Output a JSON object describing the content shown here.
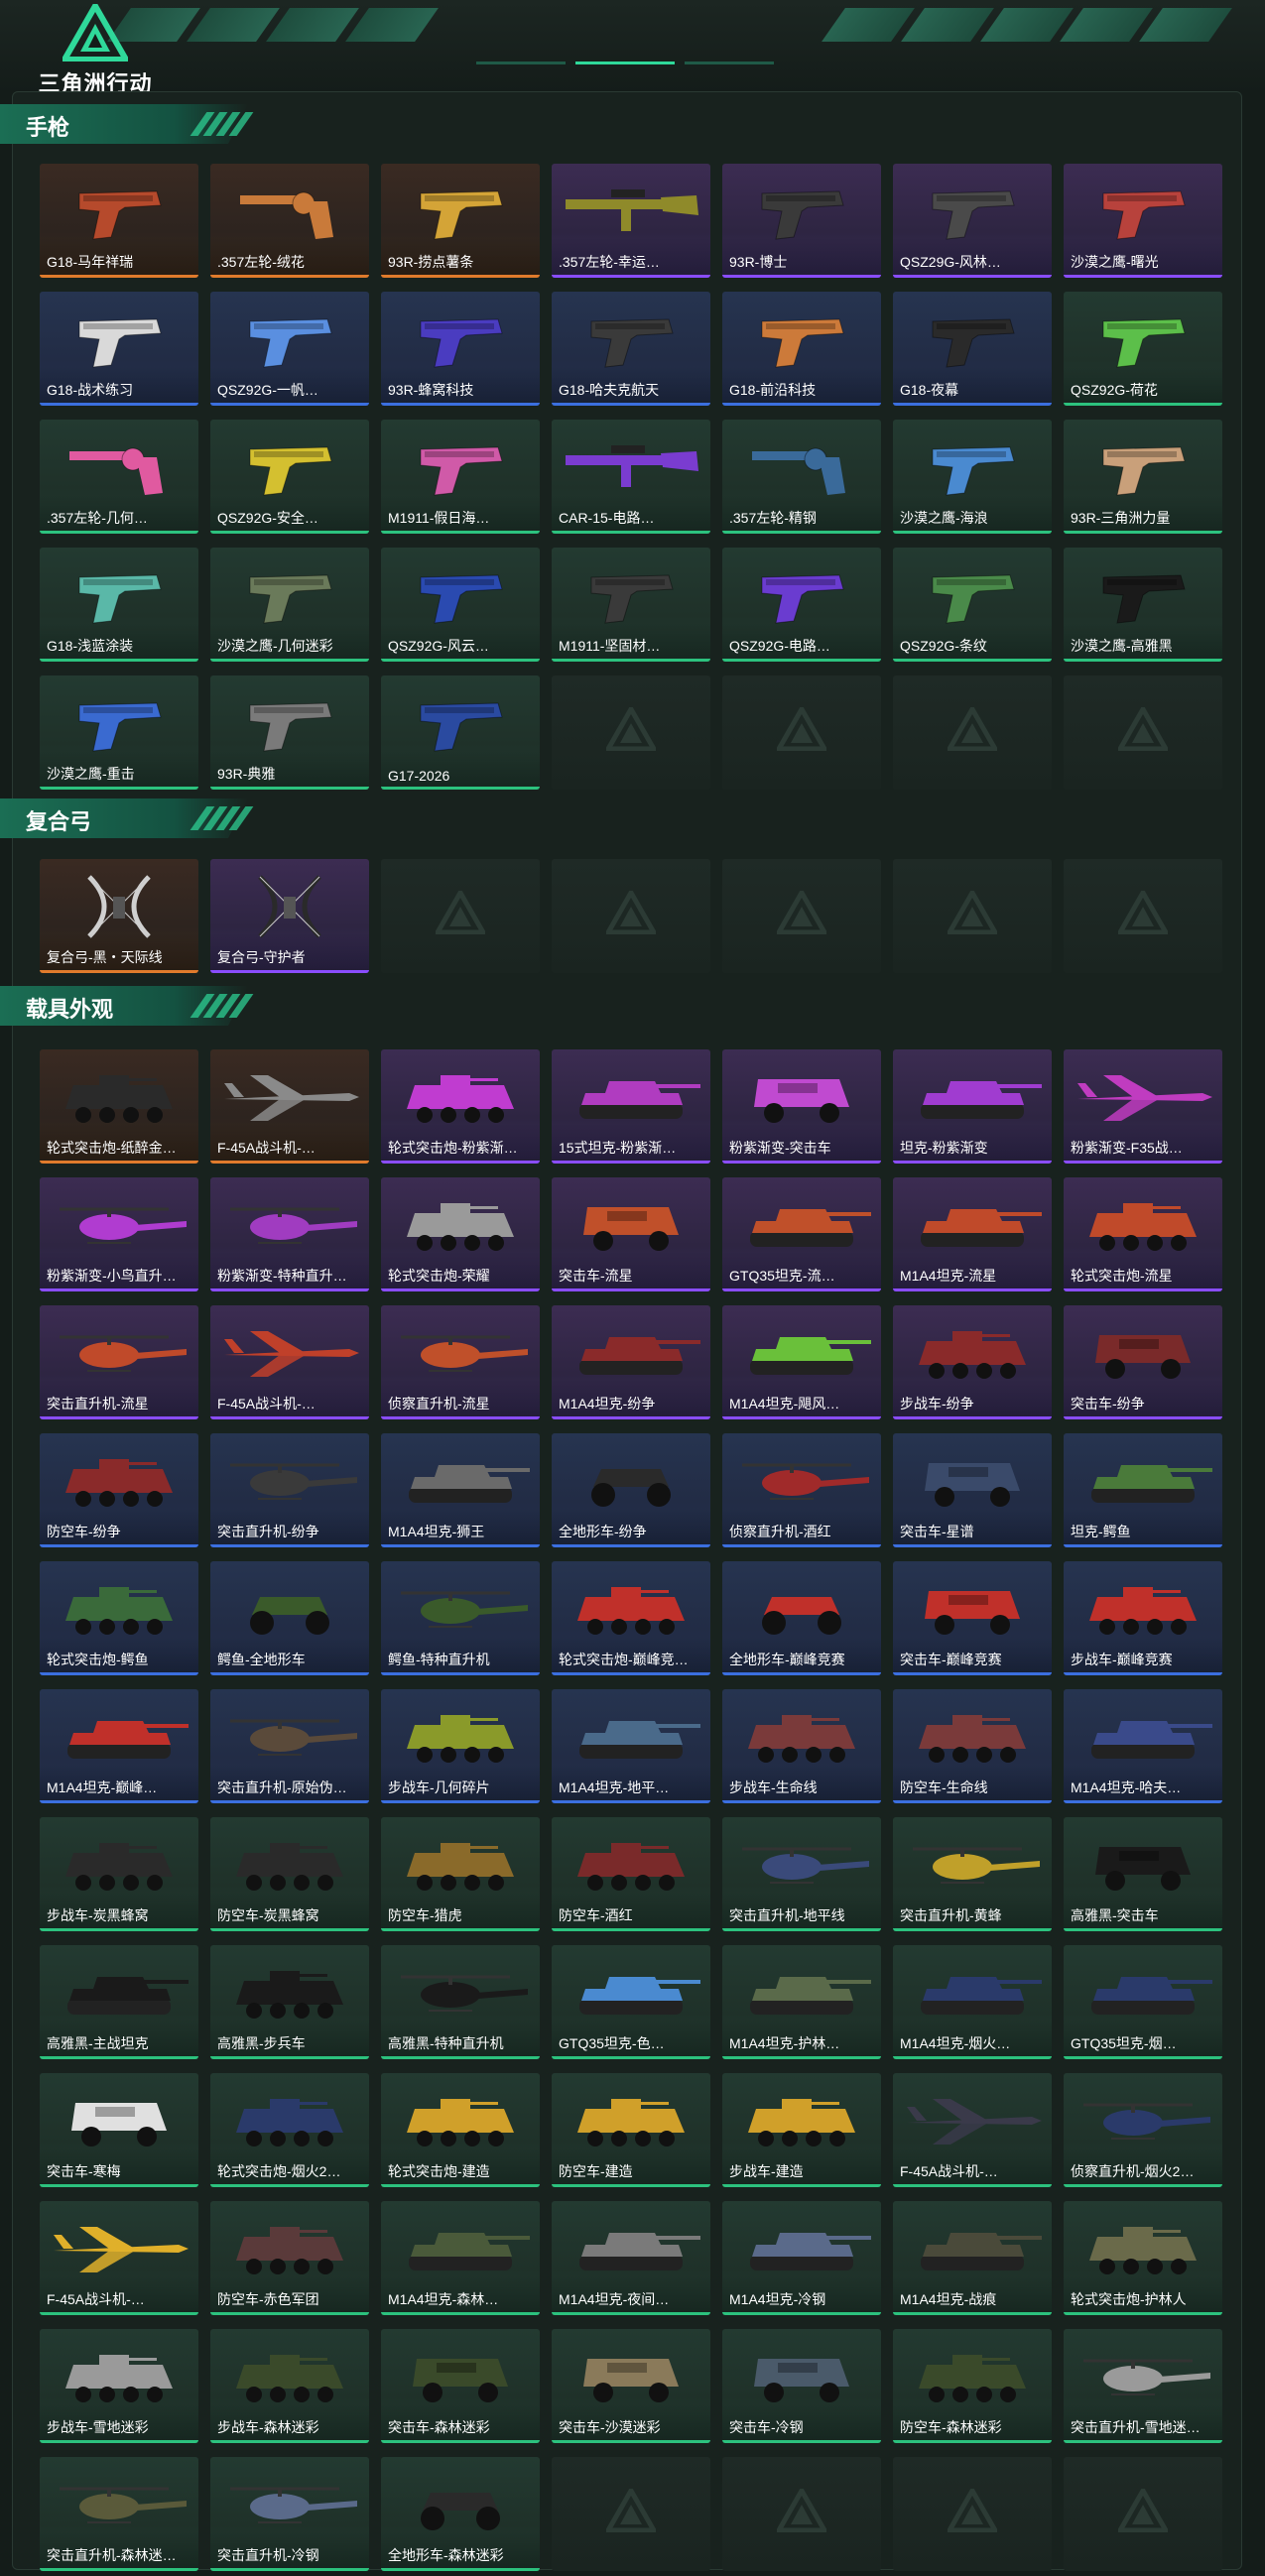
{
  "header": {
    "logo_text": "三角洲行动",
    "accent_color": "#2fd99a"
  },
  "sections": [
    {
      "title": "手枪",
      "items": [
        {
          "label": "G18-马年祥瑞",
          "rarity": "orange",
          "kind": "pistol",
          "color": "#b64a2c"
        },
        {
          "label": ".357左轮-绒花",
          "rarity": "orange",
          "kind": "revolver",
          "color": "#c97a3a"
        },
        {
          "label": "93R-捞点薯条",
          "rarity": "orange",
          "kind": "pistol",
          "color": "#d4a437"
        },
        {
          "label": ".357左轮-幸运…",
          "rarity": "purple",
          "kind": "rifle",
          "color": "#8f8a2a"
        },
        {
          "label": "93R-博士",
          "rarity": "purple",
          "kind": "pistol",
          "color": "#3a3a3a"
        },
        {
          "label": "QSZ29G-风林…",
          "rarity": "purple",
          "kind": "pistol",
          "color": "#4a4a4a"
        },
        {
          "label": "沙漠之鹰-曙光",
          "rarity": "purple",
          "kind": "pistol",
          "color": "#b8423c"
        },
        {
          "label": "G18-战术练习",
          "rarity": "blue",
          "kind": "pistol",
          "color": "#d9d9d9"
        },
        {
          "label": "QSZ92G-一帆…",
          "rarity": "blue",
          "kind": "pistol",
          "color": "#5a8fe0"
        },
        {
          "label": "93R-蜂窝科技",
          "rarity": "blue",
          "kind": "pistol",
          "color": "#4a3cc0"
        },
        {
          "label": "G18-哈夫克航天",
          "rarity": "blue",
          "kind": "pistol",
          "color": "#3a3a3a"
        },
        {
          "label": "G18-前沿科技",
          "rarity": "blue",
          "kind": "pistol",
          "color": "#cc7a3a"
        },
        {
          "label": "G18-夜幕",
          "rarity": "blue",
          "kind": "pistol",
          "color": "#2a2a2a"
        },
        {
          "label": "QSZ92G-荷花",
          "rarity": "green",
          "kind": "pistol",
          "color": "#5cbf4a"
        },
        {
          "label": ".357左轮-几何…",
          "rarity": "green",
          "kind": "revolver",
          "color": "#e05aa0"
        },
        {
          "label": "QSZ92G-安全…",
          "rarity": "green",
          "kind": "pistol",
          "color": "#d4c030"
        },
        {
          "label": "M1911-假日海…",
          "rarity": "green",
          "kind": "pistol",
          "color": "#d05aa8"
        },
        {
          "label": "CAR-15-电路…",
          "rarity": "green",
          "kind": "rifle",
          "color": "#7a3cd0"
        },
        {
          "label": ".357左轮-精钢",
          "rarity": "green",
          "kind": "revolver",
          "color": "#3a6a9a"
        },
        {
          "label": "沙漠之鹰-海浪",
          "rarity": "green",
          "kind": "pistol",
          "color": "#4a8ad0"
        },
        {
          "label": "93R-三角洲力量",
          "rarity": "green",
          "kind": "pistol",
          "color": "#c9a07a"
        },
        {
          "label": "G18-浅蓝涂装",
          "rarity": "green",
          "kind": "pistol",
          "color": "#5ab8a8"
        },
        {
          "label": "沙漠之鹰-几何迷彩",
          "rarity": "green",
          "kind": "pistol",
          "color": "#6a7a5a"
        },
        {
          "label": "QSZ92G-风云…",
          "rarity": "green",
          "kind": "pistol",
          "color": "#2a4ab0"
        },
        {
          "label": "M1911-坚固材…",
          "rarity": "green",
          "kind": "pistol",
          "color": "#3a3a3a"
        },
        {
          "label": "QSZ92G-电路…",
          "rarity": "green",
          "kind": "pistol",
          "color": "#6a3cd0"
        },
        {
          "label": "QSZ92G-条纹",
          "rarity": "green",
          "kind": "pistol",
          "color": "#4a8a4a"
        },
        {
          "label": "沙漠之鹰-高雅黑",
          "rarity": "green",
          "kind": "pistol",
          "color": "#1a1a1a"
        },
        {
          "label": "沙漠之鹰-重击",
          "rarity": "green",
          "kind": "pistol",
          "color": "#3a6ad0"
        },
        {
          "label": "93R-典雅",
          "rarity": "green",
          "kind": "pistol",
          "color": "#7a7a7a"
        },
        {
          "label": "G17-2026",
          "rarity": "green",
          "kind": "pistol",
          "color": "#2a4aa0"
        }
      ],
      "empty_slots": 4
    },
    {
      "title": "复合弓",
      "items": [
        {
          "label": "复合弓-黑・天际线",
          "rarity": "orange",
          "kind": "bow",
          "color": "#d0d0d0"
        },
        {
          "label": "复合弓-守护者",
          "rarity": "purple",
          "kind": "bow",
          "color": "#2a2a2a"
        }
      ],
      "empty_slots": 5
    },
    {
      "title": "载具外观",
      "items": [
        {
          "label": "轮式突击炮-纸醉金…",
          "rarity": "orange",
          "kind": "apc",
          "color": "#2a2a2a"
        },
        {
          "label": "F-45A战斗机-…",
          "rarity": "orange",
          "kind": "jet",
          "color": "#8a8a8a"
        },
        {
          "label": "轮式突击炮-粉紫渐…",
          "rarity": "purple",
          "kind": "apc",
          "color": "#c03cd0"
        },
        {
          "label": "15式坦克-粉紫渐…",
          "rarity": "purple",
          "kind": "tank",
          "color": "#b03cc0"
        },
        {
          "label": "粉紫渐变-突击车",
          "rarity": "purple",
          "kind": "truck",
          "color": "#c04ad0"
        },
        {
          "label": "坦克-粉紫渐变",
          "rarity": "purple",
          "kind": "tank",
          "color": "#a03cd0"
        },
        {
          "label": "粉紫渐变-F35战…",
          "rarity": "purple",
          "kind": "jet",
          "color": "#c03cc0"
        },
        {
          "label": "粉紫渐变-小鸟直升…",
          "rarity": "purple",
          "kind": "heli",
          "color": "#b03cd0"
        },
        {
          "label": "粉紫渐变-特种直升…",
          "rarity": "purple",
          "kind": "heli",
          "color": "#a03cc0"
        },
        {
          "label": "轮式突击炮-荣耀",
          "rarity": "purple",
          "kind": "apc",
          "color": "#9a9a9a"
        },
        {
          "label": "突击车-流星",
          "rarity": "purple",
          "kind": "truck",
          "color": "#c0502a"
        },
        {
          "label": "GTQ35坦克-流…",
          "rarity": "purple",
          "kind": "tank",
          "color": "#c0502a"
        },
        {
          "label": "M1A4坦克-流星",
          "rarity": "purple",
          "kind": "tank",
          "color": "#c04a2a"
        },
        {
          "label": "轮式突击炮-流星",
          "rarity": "purple",
          "kind": "apc",
          "color": "#c04a2a"
        },
        {
          "label": "突击直升机-流星",
          "rarity": "purple",
          "kind": "heli",
          "color": "#c04a2a"
        },
        {
          "label": "F-45A战斗机-…",
          "rarity": "purple",
          "kind": "jet",
          "color": "#c0402a"
        },
        {
          "label": "侦察直升机-流星",
          "rarity": "purple",
          "kind": "heli",
          "color": "#c0502a"
        },
        {
          "label": "M1A4坦克-纷争",
          "rarity": "purple",
          "kind": "tank",
          "color": "#8a2a2a"
        },
        {
          "label": "M1A4坦克-飓风…",
          "rarity": "purple",
          "kind": "tank",
          "color": "#6ac03a"
        },
        {
          "label": "步战车-纷争",
          "rarity": "purple",
          "kind": "apc",
          "color": "#8a2a2a"
        },
        {
          "label": "突击车-纷争",
          "rarity": "purple",
          "kind": "truck",
          "color": "#7a2a2a"
        },
        {
          "label": "防空车-纷争",
          "rarity": "blue",
          "kind": "apc",
          "color": "#8a2a2a"
        },
        {
          "label": "突击直升机-纷争",
          "rarity": "blue",
          "kind": "heli",
          "color": "#3a3a3a"
        },
        {
          "label": "M1A4坦克-狮王",
          "rarity": "blue",
          "kind": "tank",
          "color": "#6a6a6a"
        },
        {
          "label": "全地形车-纷争",
          "rarity": "blue",
          "kind": "atv",
          "color": "#2a2a2a"
        },
        {
          "label": "侦察直升机-酒红",
          "rarity": "blue",
          "kind": "heli",
          "color": "#a02a2a"
        },
        {
          "label": "突击车-星谱",
          "rarity": "blue",
          "kind": "truck",
          "color": "#3a4a6a"
        },
        {
          "label": "坦克-鳄鱼",
          "rarity": "blue",
          "kind": "tank",
          "color": "#4a7a3a"
        },
        {
          "label": "轮式突击炮-鳄鱼",
          "rarity": "blue",
          "kind": "apc",
          "color": "#3a6a3a"
        },
        {
          "label": "鳄鱼-全地形车",
          "rarity": "blue",
          "kind": "atv",
          "color": "#3a5a2a"
        },
        {
          "label": "鳄鱼-特种直升机",
          "rarity": "blue",
          "kind": "heli",
          "color": "#3a5a2a"
        },
        {
          "label": "轮式突击炮-巅峰竞…",
          "rarity": "blue",
          "kind": "apc",
          "color": "#c0302a"
        },
        {
          "label": "全地形车-巅峰竞赛",
          "rarity": "blue",
          "kind": "atv",
          "color": "#c0302a"
        },
        {
          "label": "突击车-巅峰竞赛",
          "rarity": "blue",
          "kind": "truck",
          "color": "#c0302a"
        },
        {
          "label": "步战车-巅峰竞赛",
          "rarity": "blue",
          "kind": "apc",
          "color": "#c0302a"
        },
        {
          "label": "M1A4坦克-巅峰…",
          "rarity": "blue",
          "kind": "tank",
          "color": "#c0302a"
        },
        {
          "label": "突击直升机-原始伪…",
          "rarity": "blue",
          "kind": "heli",
          "color": "#5a4a3a"
        },
        {
          "label": "步战车-几何碎片",
          "rarity": "blue",
          "kind": "apc",
          "color": "#8a9a2a"
        },
        {
          "label": "M1A4坦克-地平…",
          "rarity": "blue",
          "kind": "tank",
          "color": "#4a6a8a"
        },
        {
          "label": "步战车-生命线",
          "rarity": "blue",
          "kind": "apc",
          "color": "#7a3a3a"
        },
        {
          "label": "防空车-生命线",
          "rarity": "blue",
          "kind": "apc",
          "color": "#7a3a3a"
        },
        {
          "label": "M1A4坦克-哈夫…",
          "rarity": "blue",
          "kind": "tank",
          "color": "#3a4a8a"
        },
        {
          "label": "步战车-炭黑蜂窝",
          "rarity": "green",
          "kind": "apc",
          "color": "#2a2a2a"
        },
        {
          "label": "防空车-炭黑蜂窝",
          "rarity": "green",
          "kind": "apc",
          "color": "#2a2a2a"
        },
        {
          "label": "防空车-猎虎",
          "rarity": "green",
          "kind": "apc",
          "color": "#8a6a2a"
        },
        {
          "label": "防空车-酒红",
          "rarity": "green",
          "kind": "apc",
          "color": "#7a2a2a"
        },
        {
          "label": "突击直升机-地平线",
          "rarity": "green",
          "kind": "heli",
          "color": "#3a4a7a"
        },
        {
          "label": "突击直升机-黄蜂",
          "rarity": "green",
          "kind": "heli",
          "color": "#c0a02a"
        },
        {
          "label": "高雅黑-突击车",
          "rarity": "green",
          "kind": "truck",
          "color": "#1a1a1a"
        },
        {
          "label": "高雅黑-主战坦克",
          "rarity": "green",
          "kind": "tank",
          "color": "#1a1a1a"
        },
        {
          "label": "高雅黑-步兵车",
          "rarity": "green",
          "kind": "apc",
          "color": "#1a1a1a"
        },
        {
          "label": "高雅黑-特种直升机",
          "rarity": "green",
          "kind": "heli",
          "color": "#1a1a1a"
        },
        {
          "label": "GTQ35坦克-色…",
          "rarity": "green",
          "kind": "tank",
          "color": "#4a8ad0"
        },
        {
          "label": "M1A4坦克-护林…",
          "rarity": "green",
          "kind": "tank",
          "color": "#5a6a4a"
        },
        {
          "label": "M1A4坦克-烟火…",
          "rarity": "green",
          "kind": "tank",
          "color": "#2a3a6a"
        },
        {
          "label": "GTQ35坦克-烟…",
          "rarity": "green",
          "kind": "tank",
          "color": "#2a3a6a"
        },
        {
          "label": "突击车-寒梅",
          "rarity": "green",
          "kind": "truck",
          "color": "#e0e0e0"
        },
        {
          "label": "轮式突击炮-烟火2…",
          "rarity": "green",
          "kind": "apc",
          "color": "#2a3a6a"
        },
        {
          "label": "轮式突击炮-建造",
          "rarity": "green",
          "kind": "apc",
          "color": "#d0a02a"
        },
        {
          "label": "防空车-建造",
          "rarity": "green",
          "kind": "apc",
          "color": "#d0a02a"
        },
        {
          "label": "步战车-建造",
          "rarity": "green",
          "kind": "apc",
          "color": "#d0a02a"
        },
        {
          "label": "F-45A战斗机-…",
          "rarity": "green",
          "kind": "jet",
          "color": "#3a3a4a"
        },
        {
          "label": "侦察直升机-烟火2…",
          "rarity": "green",
          "kind": "heli",
          "color": "#2a3a6a"
        },
        {
          "label": "F-45A战斗机-…",
          "rarity": "green",
          "kind": "jet",
          "color": "#e0b02a"
        },
        {
          "label": "防空车-赤色军团",
          "rarity": "green",
          "kind": "apc",
          "color": "#5a3a3a"
        },
        {
          "label": "M1A4坦克-森林…",
          "rarity": "green",
          "kind": "tank",
          "color": "#4a5a3a"
        },
        {
          "label": "M1A4坦克-夜间…",
          "rarity": "green",
          "kind": "tank",
          "color": "#7a7a7a"
        },
        {
          "label": "M1A4坦克-冷钢",
          "rarity": "green",
          "kind": "tank",
          "color": "#5a6a8a"
        },
        {
          "label": "M1A4坦克-战痕",
          "rarity": "green",
          "kind": "tank",
          "color": "#4a4a3a"
        },
        {
          "label": "轮式突击炮-护林人",
          "rarity": "green",
          "kind": "apc",
          "color": "#6a6a4a"
        },
        {
          "label": "步战车-雪地迷彩",
          "rarity": "green",
          "kind": "apc",
          "color": "#9a9a9a"
        },
        {
          "label": "步战车-森林迷彩",
          "rarity": "green",
          "kind": "apc",
          "color": "#3a4a2a"
        },
        {
          "label": "突击车-森林迷彩",
          "rarity": "green",
          "kind": "truck",
          "color": "#3a4a2a"
        },
        {
          "label": "突击车-沙漠迷彩",
          "rarity": "green",
          "kind": "truck",
          "color": "#8a7a5a"
        },
        {
          "label": "突击车-冷钢",
          "rarity": "green",
          "kind": "truck",
          "color": "#4a5a6a"
        },
        {
          "label": "防空车-森林迷彩",
          "rarity": "green",
          "kind": "apc",
          "color": "#3a4a2a"
        },
        {
          "label": "突击直升机-雪地迷…",
          "rarity": "green",
          "kind": "heli",
          "color": "#9a9a9a"
        },
        {
          "label": "突击直升机-森林迷…",
          "rarity": "green",
          "kind": "heli",
          "color": "#5a5a3a"
        },
        {
          "label": "突击直升机-冷钢",
          "rarity": "green",
          "kind": "heli",
          "color": "#5a6a8a"
        },
        {
          "label": "全地形车-森林迷彩",
          "rarity": "green",
          "kind": "atv",
          "color": "#2a2a2a"
        }
      ],
      "empty_slots": 4
    }
  ]
}
